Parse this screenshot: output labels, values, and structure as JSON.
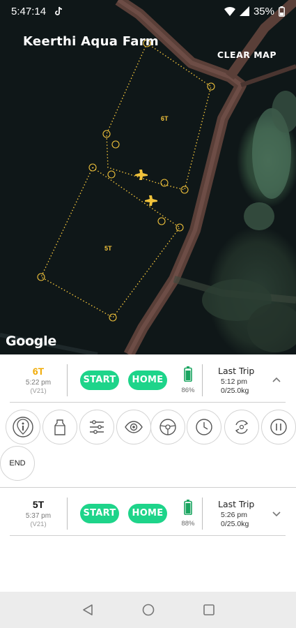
{
  "status_bar": {
    "time": "5:47:14",
    "battery_percent": "35%",
    "icons": [
      "tiktok-icon",
      "wifi-icon",
      "signal-icon",
      "battery-icon"
    ]
  },
  "map": {
    "farm_name": "Keerthi Aqua Farm",
    "clear_map_label": "CLEAR MAP",
    "google_logo": "Google",
    "pond_labels": [
      "6T",
      "5T"
    ],
    "waypoints_6t": [
      "①",
      "②",
      "③",
      "④",
      "⑤",
      "⑥",
      "⑦"
    ],
    "waypoints_5t": [
      "①",
      "②",
      "③",
      "④",
      "⑤",
      "⑥"
    ],
    "path_color": "#f0c23b"
  },
  "drones": [
    {
      "name": "6T",
      "time": "5:22 pm",
      "version": "(V21)",
      "start_label": "START",
      "home_label": "HOME",
      "battery": "86%",
      "last_trip_title": "Last Trip",
      "last_trip_time": "5:12 pm",
      "last_trip_weight": "0/25.0kg",
      "expanded": true
    },
    {
      "name": "5T",
      "time": "5:37 pm",
      "version": "(V21)",
      "start_label": "START",
      "home_label": "HOME",
      "battery": "88%",
      "last_trip_title": "Last Trip",
      "last_trip_time": "5:26 pm",
      "last_trip_weight": "0/25.0kg",
      "expanded": false
    }
  ],
  "controls": {
    "icons": [
      "location-info-icon",
      "feeder-icon",
      "settings-sliders-icon",
      "eye-icon",
      "steering-icon",
      "clock-icon",
      "refresh-cycle-icon",
      "pause-icon"
    ],
    "end_label": "END"
  },
  "colors": {
    "accent_green": "#1ed48a",
    "active_drone": "#f0a900"
  },
  "nav_bar": {
    "icons": [
      "back-icon",
      "home-icon",
      "recents-icon"
    ]
  }
}
